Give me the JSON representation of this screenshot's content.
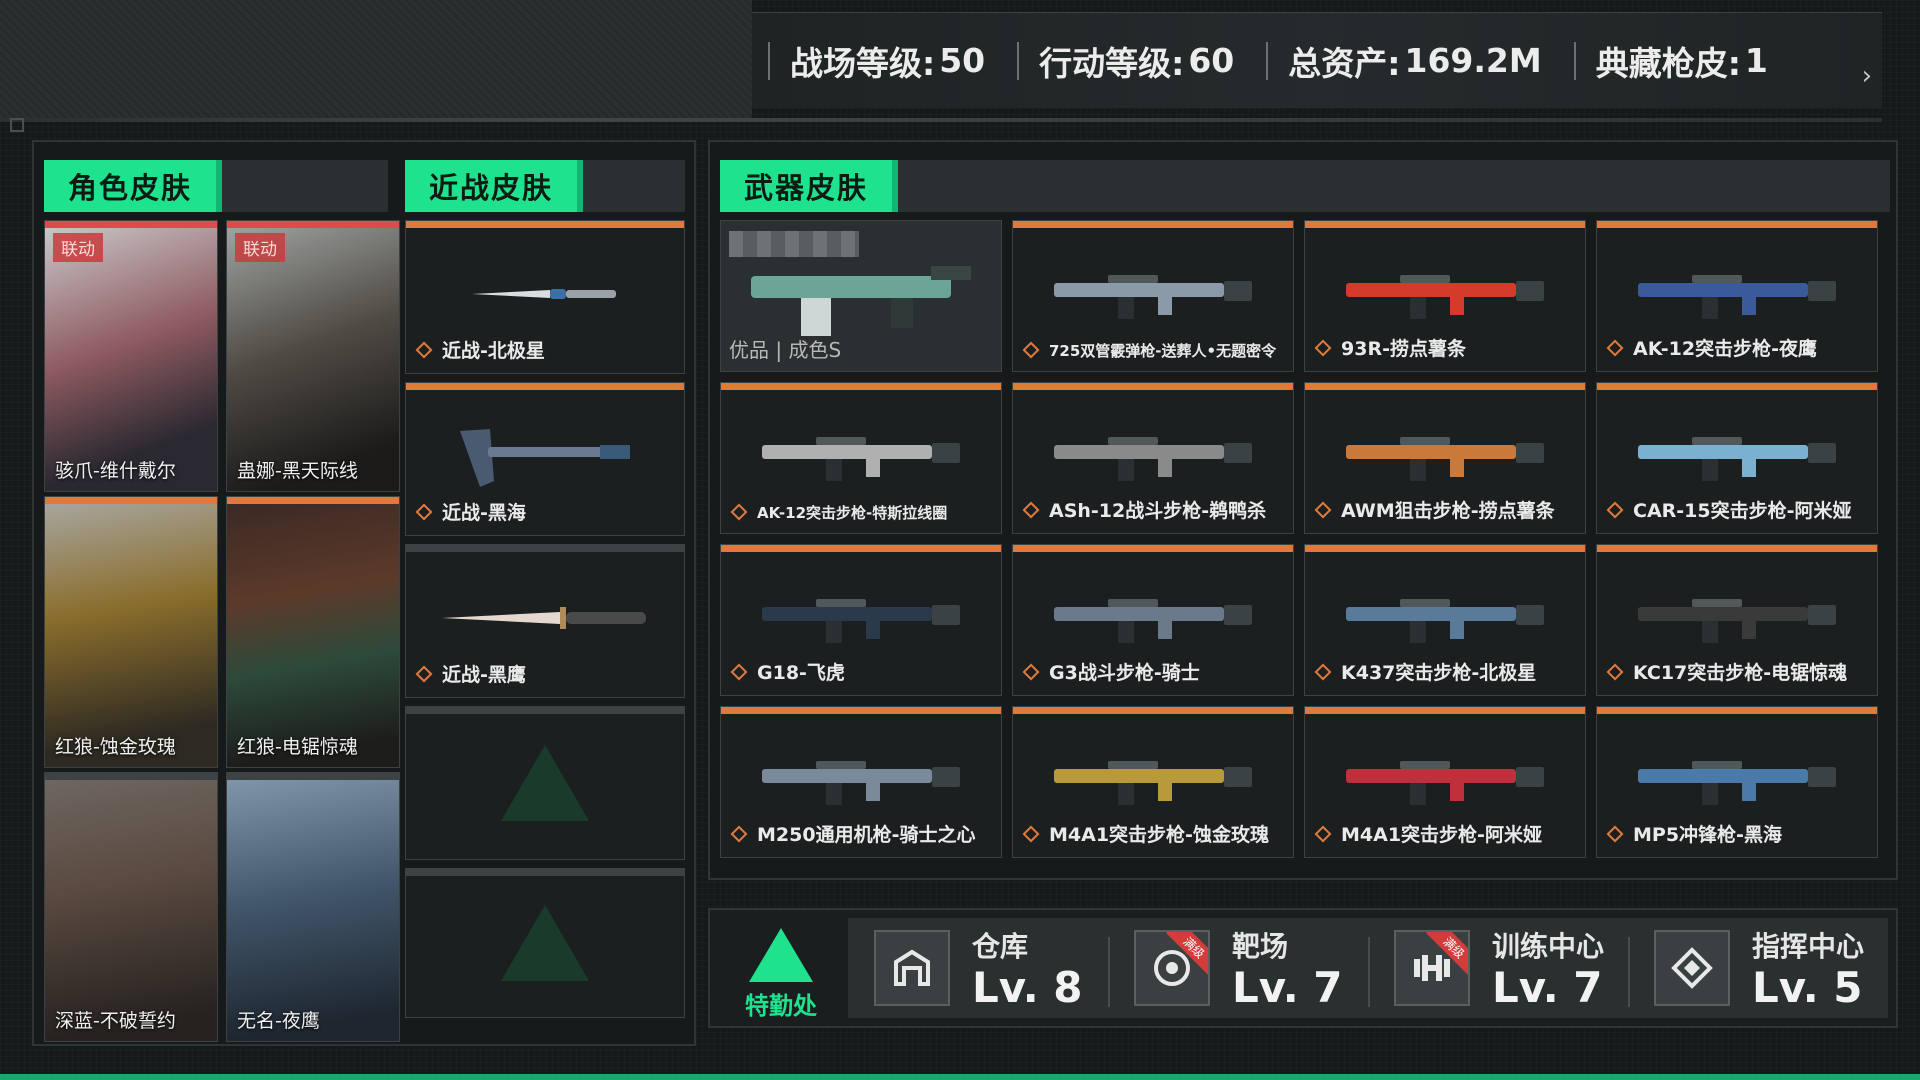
{
  "topbar": {
    "stats": [
      {
        "label": "战场等级:",
        "value": "50"
      },
      {
        "label": "行动等级: ",
        "value": "60"
      },
      {
        "label": "总资产:",
        "value": "169.2M"
      },
      {
        "label": "典藏枪皮:",
        "value": "1"
      }
    ]
  },
  "sections": {
    "character": "角色皮肤",
    "melee": "近战皮肤",
    "weapon": "武器皮肤"
  },
  "character_skins": [
    {
      "name": "骇爪-维什戴尔",
      "badge": "联动"
    },
    {
      "name": "蛊娜-黑天际线",
      "badge": "联动"
    },
    {
      "name": "红狼-蚀金玫瑰",
      "badge": ""
    },
    {
      "name": "红狼-电锯惊魂",
      "badge": ""
    },
    {
      "name": "深蓝-不破誓约",
      "badge": ""
    },
    {
      "name": "无名-夜鹰",
      "badge": ""
    }
  ],
  "melee_skins": [
    {
      "name": "近战-北极星"
    },
    {
      "name": "近战-黑海"
    },
    {
      "name": "近战-黑鹰"
    }
  ],
  "weapon_featured": {
    "quality": "优品 | 成色S"
  },
  "weapon_skins": [
    {
      "name": "725双管霰弹枪-送葬人•无题密令"
    },
    {
      "name": "93R-捞点薯条"
    },
    {
      "name": "AK-12突击步枪-夜鹰"
    },
    {
      "name": "AK-12突击步枪-特斯拉线圈"
    },
    {
      "name": "ASh-12战斗步枪-鹈鸭杀"
    },
    {
      "name": "AWM狙击步枪-捞点薯条"
    },
    {
      "name": "CAR-15突击步枪-阿米娅"
    },
    {
      "name": "G18-飞虎"
    },
    {
      "name": "G3战斗步枪-骑士"
    },
    {
      "name": "K437突击步枪-北极星"
    },
    {
      "name": "KC17突击步枪-电锯惊魂"
    },
    {
      "name": "M250通用机枪-骑士之心"
    },
    {
      "name": "M4A1突击步枪-蚀金玫瑰"
    },
    {
      "name": "M4A1突击步枪-阿米娅"
    },
    {
      "name": "MP5冲锋枪-黑海"
    }
  ],
  "facility": {
    "logo": "特勤处",
    "items": [
      {
        "title": "仓库",
        "level": "Lv. 8",
        "max": "",
        "icon": "warehouse-icon"
      },
      {
        "title": "靶场",
        "level": "Lv. 7",
        "max": "满级",
        "icon": "target-icon"
      },
      {
        "title": "训练中心",
        "level": "Lv. 7",
        "max": "满级",
        "icon": "dumbbell-icon"
      },
      {
        "title": "指挥中心",
        "level": "Lv. 5",
        "max": "",
        "icon": "command-icon"
      }
    ]
  },
  "colors": {
    "accent": "#1ee28e",
    "stripe": "#e07a3c",
    "collab": "#e04a4a"
  }
}
